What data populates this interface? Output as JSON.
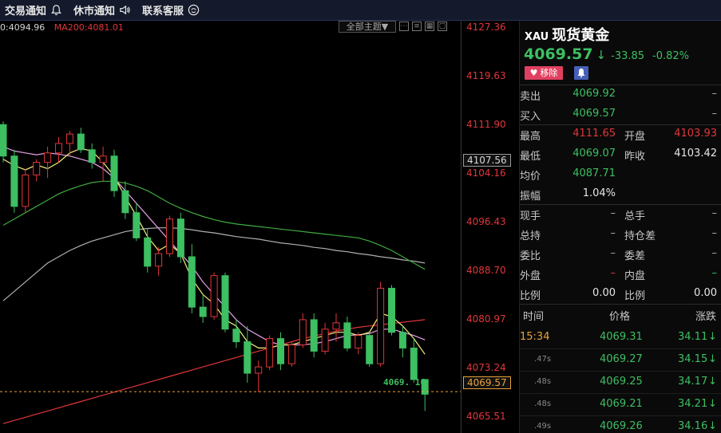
{
  "nav": {
    "items": [
      {
        "label": "交易通知",
        "icon": "bell-icon"
      },
      {
        "label": "休市通知",
        "icon": "speaker-icon"
      },
      {
        "label": "联系客服",
        "icon": "support-icon"
      }
    ]
  },
  "chart": {
    "ma_left": "0:4094.96",
    "ma200": "MA200:4081.01",
    "theme_label": "全部主题▼",
    "tool_icons": [
      "more-icon",
      "list-icon",
      "grid-icon",
      "window-icon"
    ],
    "current_price_label": "4069. 16",
    "colors": {
      "up": "#e0363a",
      "down": "#3dbf62",
      "ma5": "#f2f27a",
      "ma10": "#e8a0e8",
      "ma20": "#b0b0b0",
      "ma60": "#3faa3f",
      "ma200": "#e0363a"
    }
  },
  "chart_data": {
    "type": "candlestick",
    "yaxis_ticks": [
      "4127.36",
      "4119.63",
      "4111.90",
      "4104.16",
      "4096.43",
      "4088.70",
      "4080.97",
      "4073.24",
      "4065.51"
    ],
    "boxed_labels": {
      "high_box": "4107.56",
      "current_box": "4069.57"
    },
    "ylim": [
      4063.0,
      4128.5
    ],
    "candles": [
      [
        4112.0,
        4112.5,
        4106.0,
        4107.0
      ],
      [
        4107.0,
        4108.0,
        4098.0,
        4099.0
      ],
      [
        4099.0,
        4105.0,
        4098.0,
        4104.0
      ],
      [
        4104.0,
        4106.5,
        4103.0,
        4106.0
      ],
      [
        4106.0,
        4108.5,
        4103.5,
        4107.5
      ],
      [
        4107.5,
        4110.0,
        4106.0,
        4109.0
      ],
      [
        4109.0,
        4111.0,
        4107.0,
        4110.5
      ],
      [
        4110.5,
        4111.5,
        4107.5,
        4108.0
      ],
      [
        4108.0,
        4109.0,
        4105.0,
        4106.0
      ],
      [
        4106.0,
        4108.5,
        4103.0,
        4107.0
      ],
      [
        4107.0,
        4108.0,
        4100.5,
        4101.5
      ],
      [
        4101.5,
        4103.0,
        4097.0,
        4098.0
      ],
      [
        4098.0,
        4099.5,
        4093.5,
        4094.0
      ],
      [
        4094.0,
        4095.5,
        4088.5,
        4089.5
      ],
      [
        4089.5,
        4092.5,
        4088.0,
        4091.5
      ],
      [
        4091.5,
        4097.5,
        4091.0,
        4097.0
      ],
      [
        4097.0,
        4098.0,
        4090.0,
        4091.0
      ],
      [
        4091.0,
        4093.0,
        4082.0,
        4083.0
      ],
      [
        4083.0,
        4085.0,
        4080.5,
        4081.5
      ],
      [
        4081.5,
        4088.5,
        4081.0,
        4088.0
      ],
      [
        4088.0,
        4088.5,
        4079.0,
        4079.5
      ],
      [
        4079.5,
        4081.0,
        4076.5,
        4077.5
      ],
      [
        4077.5,
        4080.0,
        4071.0,
        4072.5
      ],
      [
        4072.5,
        4074.5,
        4069.5,
        4073.5
      ],
      [
        4073.5,
        4078.5,
        4073.0,
        4078.0
      ],
      [
        4078.0,
        4079.0,
        4073.0,
        4074.0
      ],
      [
        4074.0,
        4077.5,
        4073.5,
        4077.0
      ],
      [
        4077.0,
        4082.0,
        4076.5,
        4081.0
      ],
      [
        4081.0,
        4082.0,
        4075.0,
        4076.0
      ],
      [
        4076.0,
        4080.5,
        4075.5,
        4079.5
      ],
      [
        4079.5,
        4082.0,
        4077.5,
        4080.5
      ],
      [
        4080.5,
        4081.5,
        4076.0,
        4076.5
      ],
      [
        4076.5,
        4079.0,
        4075.5,
        4078.5
      ],
      [
        4078.5,
        4079.0,
        4073.5,
        4074.0
      ],
      [
        4074.0,
        4087.0,
        4073.5,
        4086.0
      ],
      [
        4086.0,
        4086.5,
        4078.5,
        4079.0
      ],
      [
        4079.0,
        4080.0,
        4075.0,
        4076.5
      ],
      [
        4076.5,
        4078.0,
        4071.0,
        4071.5
      ],
      [
        4071.5,
        4071.5,
        4066.5,
        4069.16
      ]
    ],
    "ma5": [
      4106.5,
      4105.5,
      4104.8,
      4105.6,
      4105.0,
      4106.0,
      4107.5,
      4108.2,
      4107.8,
      4106.0,
      4103.8,
      4100.5,
      4097.5,
      4094.2,
      4092.0,
      4093.0,
      4091.5,
      4087.5,
      4085.0,
      4083.5,
      4081.0,
      4080.0,
      4077.5,
      4076.5,
      4076.5,
      4077.0,
      4077.0,
      4077.5,
      4078.0,
      4078.5,
      4079.0,
      4079.0,
      4078.5,
      4079.0,
      4082.0,
      4081.5,
      4080.0,
      4078.0,
      4075.5
    ],
    "ma10": [
      4108.5,
      4107.8,
      4107.5,
      4107.2,
      4107.5,
      4107.3,
      4107.0,
      4106.5,
      4106.0,
      4105.0,
      4103.5,
      4101.5,
      4099.5,
      4097.5,
      4095.5,
      4093.5,
      4091.5,
      4089.5,
      4087.0,
      4085.0,
      4083.0,
      4081.0,
      4079.5,
      4078.5,
      4077.5,
      4077.0,
      4077.0,
      4077.0,
      4077.2,
      4077.5,
      4078.0,
      4078.5,
      4078.6,
      4078.8,
      4079.5,
      4079.5,
      4079.0,
      4078.5,
      4077.8
    ],
    "ma20": [
      4084.0,
      4085.5,
      4087.0,
      4088.5,
      4090.0,
      4091.0,
      4092.0,
      4092.8,
      4093.5,
      4094.0,
      4094.5,
      4095.0,
      4095.3,
      4095.5,
      4095.6,
      4095.6,
      4095.5,
      4095.3,
      4095.0,
      4094.8,
      4094.5,
      4094.2,
      4094.0,
      4093.8,
      4093.5,
      4093.2,
      4093.0,
      4092.8,
      4092.5,
      4092.3,
      4092.0,
      4091.8,
      4091.5,
      4091.3,
      4091.0,
      4090.8,
      4090.5,
      4090.3,
      4090.0
    ],
    "ma60": [
      4096.0,
      4097.0,
      4098.0,
      4099.0,
      4100.0,
      4101.0,
      4101.7,
      4102.3,
      4102.8,
      4103.0,
      4103.0,
      4102.7,
      4102.2,
      4101.5,
      4100.5,
      4099.5,
      4098.7,
      4098.0,
      4097.4,
      4096.9,
      4096.5,
      4096.2,
      4096.0,
      4095.8,
      4095.6,
      4095.4,
      4095.2,
      4095.0,
      4094.8,
      4094.6,
      4094.4,
      4094.2,
      4094.0,
      4093.5,
      4092.8,
      4092.0,
      4091.0,
      4090.0,
      4089.0
    ],
    "ma200": [
      4064.5,
      4065.0,
      4065.5,
      4066.0,
      4066.5,
      4067.0,
      4067.5,
      4068.0,
      4068.5,
      4069.0,
      4069.5,
      4070.0,
      4070.5,
      4071.0,
      4071.5,
      4072.0,
      4072.5,
      4073.0,
      4073.5,
      4074.0,
      4074.5,
      4075.0,
      4075.5,
      4076.0,
      4076.5,
      4077.0,
      4077.5,
      4078.0,
      4078.4,
      4078.8,
      4079.2,
      4079.5,
      4079.8,
      4080.0,
      4080.2,
      4080.4,
      4080.6,
      4080.8,
      4081.0
    ]
  },
  "quote": {
    "symbol": "XAU",
    "name": "现货黄金",
    "price": "4069.57",
    "arrow": "↓",
    "change": "-33.85",
    "change_pct": "-0.82%",
    "remove_label": "移除",
    "rows": [
      {
        "l1": "卖出",
        "v1": "4069.92",
        "c1": "green",
        "l2": "",
        "v2": "–",
        "c2": "dash"
      },
      {
        "l1": "买入",
        "v1": "4069.57",
        "c1": "green",
        "l2": "",
        "v2": "–",
        "c2": "dash"
      },
      {
        "l1": "最高",
        "v1": "4111.65",
        "c1": "red",
        "l2": "开盘",
        "v2": "4103.93",
        "c2": "red"
      },
      {
        "l1": "最低",
        "v1": "4069.07",
        "c1": "green",
        "l2": "昨收",
        "v2": "4103.42",
        "c2": "white"
      },
      {
        "l1": "均价",
        "v1": "4087.71",
        "c1": "green",
        "l2": "",
        "v2": "",
        "c2": "white"
      },
      {
        "l1": "振幅",
        "v1": "1.04%",
        "c1": "white",
        "l2": "",
        "v2": "",
        "c2": "white"
      },
      {
        "l1": "现手",
        "v1": "–",
        "c1": "dash",
        "l2": "总手",
        "v2": "–",
        "c2": "dash"
      },
      {
        "l1": "总持",
        "v1": "–",
        "c1": "dash",
        "l2": "持仓差",
        "v2": "–",
        "c2": "dash"
      },
      {
        "l1": "委比",
        "v1": "–",
        "c1": "dash",
        "l2": "委差",
        "v2": "–",
        "c2": "dash"
      },
      {
        "l1": "外盘",
        "v1": "–",
        "c1": "red",
        "l2": "内盘",
        "v2": "–",
        "c2": "green"
      },
      {
        "l1": "比例",
        "v1": "0.00",
        "c1": "white",
        "l2": "比例",
        "v2": "0.00",
        "c2": "white"
      }
    ],
    "ticks_header": {
      "time": "时间",
      "price": "价格",
      "change": "涨跌"
    },
    "ticks": [
      {
        "time": "15:34",
        "price": "4069.31",
        "change": "34.11"
      },
      {
        "time": ".47s",
        "price": "4069.27",
        "change": "34.15"
      },
      {
        "time": ".48s",
        "price": "4069.25",
        "change": "34.17"
      },
      {
        "time": ".48s",
        "price": "4069.21",
        "change": "34.21"
      },
      {
        "time": ".49s",
        "price": "4069.26",
        "change": "34.16"
      }
    ]
  }
}
